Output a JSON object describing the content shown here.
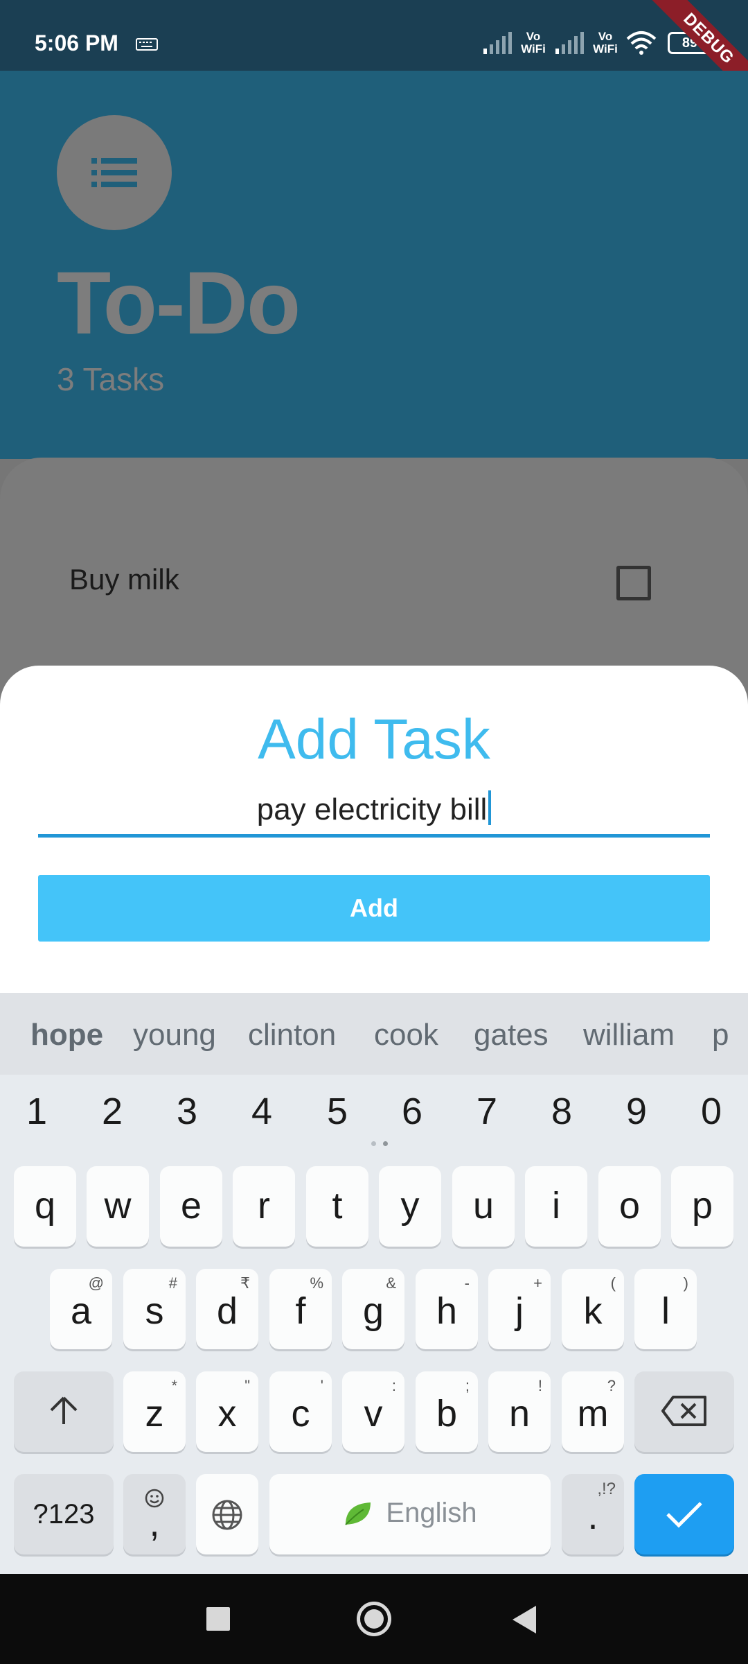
{
  "status_bar": {
    "time": "5:06 PM",
    "vowifi_1": "Vo\nWiFi",
    "vowifi_2": "Vo\nWiFi",
    "battery": "89",
    "debug_banner": "DEBUG"
  },
  "header": {
    "title": "To-Do",
    "task_count": "3 Tasks",
    "icon": "list-icon"
  },
  "tasks": [
    {
      "label": "Buy milk",
      "done": false
    }
  ],
  "add_sheet": {
    "title": "Add Task",
    "input_value": "pay electricity bill",
    "add_button": "Add"
  },
  "keyboard": {
    "suggestions": [
      "hope",
      "young",
      "clinton",
      "cook",
      "gates",
      "william",
      "p"
    ],
    "number_row": [
      "1",
      "2",
      "3",
      "4",
      "5",
      "6",
      "7",
      "8",
      "9",
      "0"
    ],
    "row1": [
      {
        "k": "q"
      },
      {
        "k": "w"
      },
      {
        "k": "e"
      },
      {
        "k": "r"
      },
      {
        "k": "t"
      },
      {
        "k": "y"
      },
      {
        "k": "u"
      },
      {
        "k": "i"
      },
      {
        "k": "o"
      },
      {
        "k": "p"
      }
    ],
    "row2": [
      {
        "k": "a",
        "s": "@"
      },
      {
        "k": "s",
        "s": "#"
      },
      {
        "k": "d",
        "s": "₹"
      },
      {
        "k": "f",
        "s": "%"
      },
      {
        "k": "g",
        "s": "&"
      },
      {
        "k": "h",
        "s": "-"
      },
      {
        "k": "j",
        "s": "+"
      },
      {
        "k": "k",
        "s": "("
      },
      {
        "k": "l",
        "s": ")"
      }
    ],
    "row3": [
      {
        "k": "z",
        "s": "*"
      },
      {
        "k": "x",
        "s": "\""
      },
      {
        "k": "c",
        "s": "'"
      },
      {
        "k": "v",
        "s": ":"
      },
      {
        "k": "b",
        "s": ";"
      },
      {
        "k": "n",
        "s": "!"
      },
      {
        "k": "m",
        "s": "?"
      }
    ],
    "symbols_key": "?123",
    "comma_key": ",",
    "space_label": "English",
    "period_key": ".",
    "period_sub": ",!?"
  },
  "colors": {
    "accent": "#3fbbee",
    "button": "#44c4f9",
    "enter_key": "#1e9ef2",
    "status_bar": "#1b3f53"
  }
}
